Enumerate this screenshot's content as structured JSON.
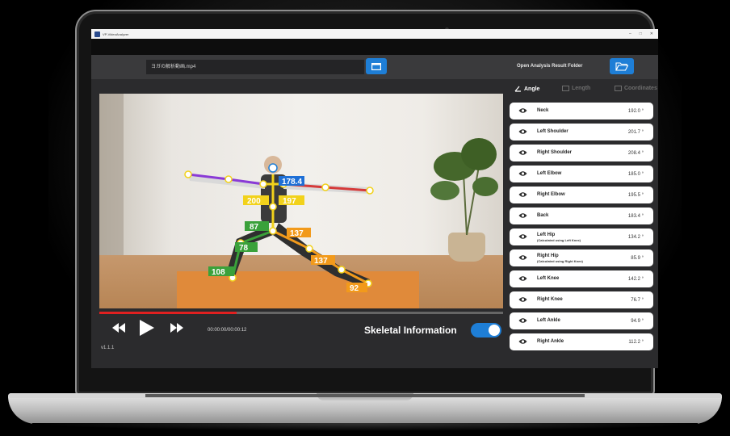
{
  "window": {
    "title": "VP-VideoAnalyzer",
    "controls": [
      "–",
      "□",
      "✕"
    ]
  },
  "toolbar": {
    "file_name": "ヨガの解析動画.mp4",
    "open_result_label": "Open Analysis Result Folder"
  },
  "tabs": [
    {
      "label": "Angle",
      "active": true
    },
    {
      "label": "Length",
      "active": false
    },
    {
      "label": "Coordinates",
      "active": false
    }
  ],
  "angles": [
    {
      "label": "Neck",
      "sub": "",
      "value": "192.0 °"
    },
    {
      "label": "Left Shoulder",
      "sub": "",
      "value": "201.7 °"
    },
    {
      "label": "Right Shoulder",
      "sub": "",
      "value": "208.4 °"
    },
    {
      "label": "Left Elbow",
      "sub": "",
      "value": "185.0 °"
    },
    {
      "label": "Right Elbow",
      "sub": "",
      "value": "195.5 °"
    },
    {
      "label": "Back",
      "sub": "",
      "value": "183.4 °"
    },
    {
      "label": "Left Hip",
      "sub": "(Calculated using Left Knee)",
      "value": "134.2 °"
    },
    {
      "label": "Right Hip",
      "sub": "(Calculated using Right Knee)",
      "value": "85.9 °"
    },
    {
      "label": "Left Knee",
      "sub": "",
      "value": "142.2 °"
    },
    {
      "label": "Right Knee",
      "sub": "",
      "value": "76.7 °"
    },
    {
      "label": "Left Ankle",
      "sub": "",
      "value": "94.9 °"
    },
    {
      "label": "Right Ankle",
      "sub": "",
      "value": "112.2 °"
    }
  ],
  "overlay_labels": [
    "178.4",
    "200",
    "197",
    "87",
    "137",
    "78",
    "137",
    "108",
    "92"
  ],
  "player": {
    "time": "00:00:00/00:00:12",
    "progress": 0.34,
    "skeletal_label": "Skeletal Information",
    "skeletal_enabled": true
  },
  "version": "v1.1.1",
  "colors": {
    "accent": "#1e7ed6",
    "progress": "#e02020",
    "overlay_yellow": "#f2d21b",
    "overlay_green": "#3aa13a"
  }
}
